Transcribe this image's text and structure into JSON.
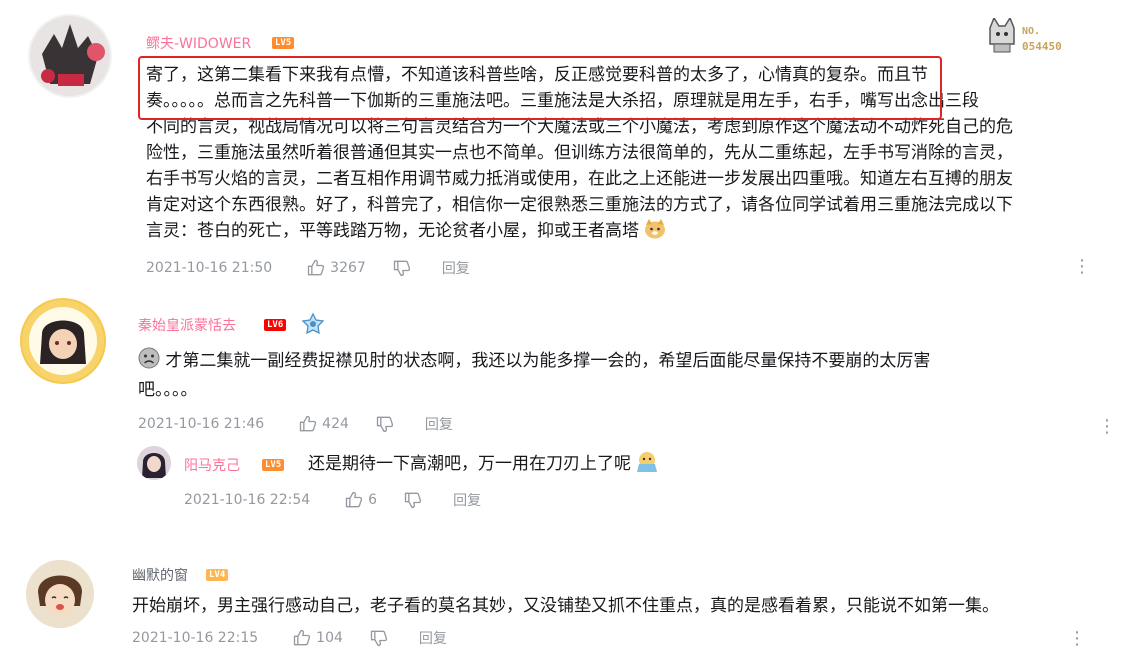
{
  "comments": [
    {
      "username": "鳏夫-WIDOWER",
      "level": "LV5",
      "badge": {
        "label": "NO.",
        "number": "054450"
      },
      "text_line1": "寄了，这第二集看下来我有点懵，不知道该科普些啥，反正感觉要科普的太多了，心情真的复杂。而且节",
      "text_line2": "奏。。。。。总而言之先科普一下伽斯的三重施法吧。三重施法是大杀招，原理就是用左手，右手，嘴写出念出三段",
      "text_line3": "不同的言灵，视战局情况可以将三句言灵结合为一个大魔法或三个小魔法，考虑到原作这个魔法动不动炸死自己的危",
      "text_line4": "险性，三重施法虽然听着很普通但其实一点也不简单。但训练方法很简单的，先从二重练起，左手书写消除的言灵，",
      "text_line5": "右手书写火焰的言灵，二者互相作用调节威力抵消或使用，在此之上还能进一步发展出四重哦。知道左右互搏的朋友",
      "text_line6": "肯定对这个东西很熟。好了，科普完了，相信你一定很熟悉三重施法的方式了，请各位同学试着用三重施法完成以下",
      "text_line7": "言灵：苍白的死亡，平等践踏万物，无论贫者小屋，抑或王者高塔",
      "time": "2021-10-16 21:50",
      "likes": "3267",
      "reply": "回复"
    },
    {
      "username": "秦始皇派蒙恬去",
      "level": "LV6",
      "text_line1": "才第二集就一副经费捉襟见肘的状态啊，我还以为能多撑一会的，希望后面能尽量保持不要崩的太厉害",
      "text_line2": "吧。。。。",
      "time": "2021-10-16 21:46",
      "likes": "424",
      "reply": "回复",
      "sub": {
        "username": "阳马克己",
        "level": "LV5",
        "text": "还是期待一下高潮吧，万一用在刀刃上了呢",
        "time": "2021-10-16 22:54",
        "likes": "6",
        "reply": "回复"
      }
    },
    {
      "username": "幽默的窗",
      "level": "LV4",
      "text": "开始崩坏，男主强行感动自己，老子看的莫名其妙，又没铺垫又抓不住重点，真的是感看着累，只能说不如第一集。",
      "time": "2021-10-16 22:15",
      "likes": "104",
      "reply": "回复"
    }
  ],
  "colors": {
    "username_pink": "#fb7299",
    "username_dark": "#61666d",
    "lv4": "#feb74f",
    "lv5": "#ff8c2f",
    "lv6": "#ff0000",
    "highlight_box": "#e02424",
    "meta_gray": "#9499a0"
  }
}
